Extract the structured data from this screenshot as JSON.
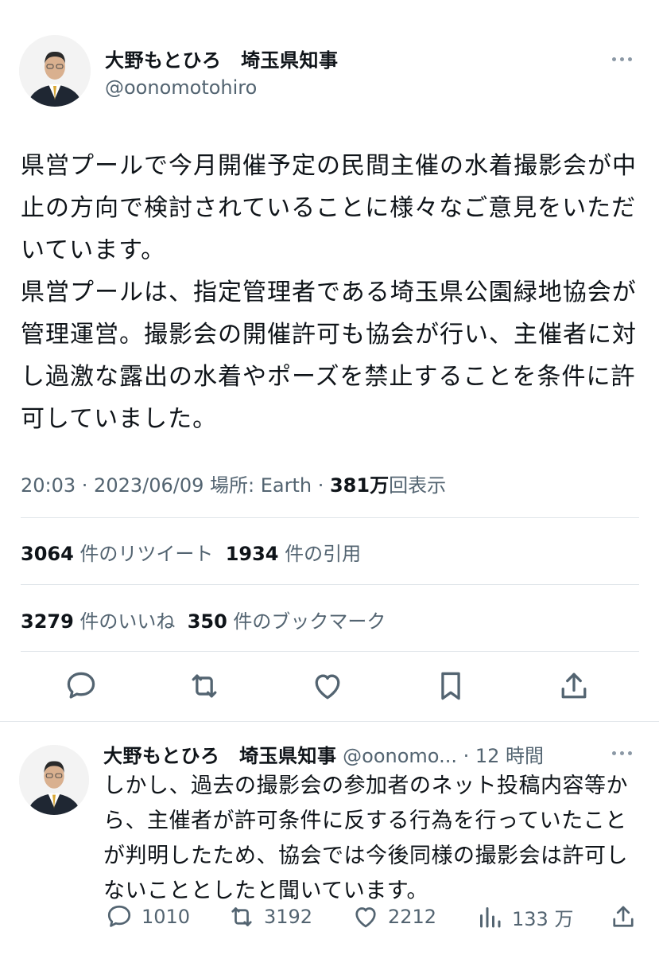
{
  "main_tweet": {
    "author_name": "大野もとひろ　埼玉県知事",
    "author_handle": "@oonomotohiro",
    "body_lines": [
      "県営プールで今月開催予定の民間主催の水着撮影会が中止の方向で検討されていることに様々なご意見をいただいています。",
      "県営プールは、指定管理者である埼玉県公園緑地協会が管理運営。撮影会の開催許可も協会が行い、主催者に対し過激な露出の水着やポーズを禁止することを条件に許可していました。"
    ],
    "timestamp": "20:03 · 2023/06/09",
    "location": " 場所: Earth · ",
    "views_count": "381万",
    "views_label": "回表示",
    "retweets_count": "3064",
    "retweets_label": " 件のリツイート  ",
    "quotes_count": "1934",
    "quotes_label": " 件の引用",
    "likes_count": "3279",
    "likes_label": " 件のいいね  ",
    "bookmarks_count": "350",
    "bookmarks_label": " 件のブックマーク"
  },
  "reply_tweet": {
    "author_name": "大野もとひろ　埼玉県知事",
    "author_handle": " @oonomo...",
    "time": " · 12 時間",
    "body": "しかし、過去の撮影会の参加者のネット投稿内容等から、主催者が許可条件に反する行為を行っていたことが判明したため、協会では今後同様の撮影会は許可しないこととしたと聞いています。",
    "replies": "1010",
    "retweets": "3192",
    "likes": "2212",
    "views": "133 万"
  },
  "icons": {
    "reply": "speech-bubble-icon",
    "retweet": "retweet-arrows-icon",
    "like": "heart-icon",
    "bookmark": "bookmark-icon",
    "share": "share-upload-icon",
    "views": "bar-chart-icon",
    "more": "ellipsis-icon"
  },
  "colors": {
    "text": "#0f1419",
    "secondary": "#536471",
    "icon": "#536471",
    "divider": "#e1e6ea"
  }
}
